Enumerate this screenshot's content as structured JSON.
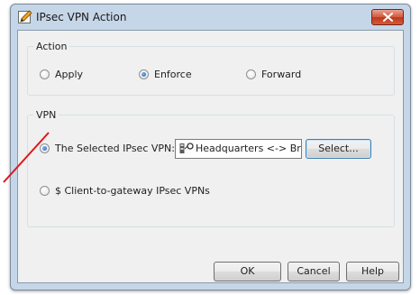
{
  "window": {
    "title": "IPsec VPN Action",
    "title_icon": "pencil-icon",
    "close_icon": "close-icon"
  },
  "action_group": {
    "label": "Action",
    "options": [
      {
        "label": "Apply",
        "checked": false
      },
      {
        "label": "Enforce",
        "checked": true
      },
      {
        "label": "Forward",
        "checked": false
      }
    ]
  },
  "vpn_group": {
    "label": "VPN",
    "selected_option": {
      "label": "The Selected IPsec VPN:",
      "checked": true
    },
    "field_value": "Headquarters <-> Bra",
    "field_icon": "vpn-community-icon",
    "select_button": "Select...",
    "client_option": {
      "label": "$ Client-to-gateway IPsec VPNs",
      "checked": false
    }
  },
  "buttons": {
    "ok": "OK",
    "cancel": "Cancel",
    "help": "Help"
  },
  "colors": {
    "annotation": "#e0141b",
    "close": "#c8462a",
    "radio_selected": "#1c5fb6"
  }
}
